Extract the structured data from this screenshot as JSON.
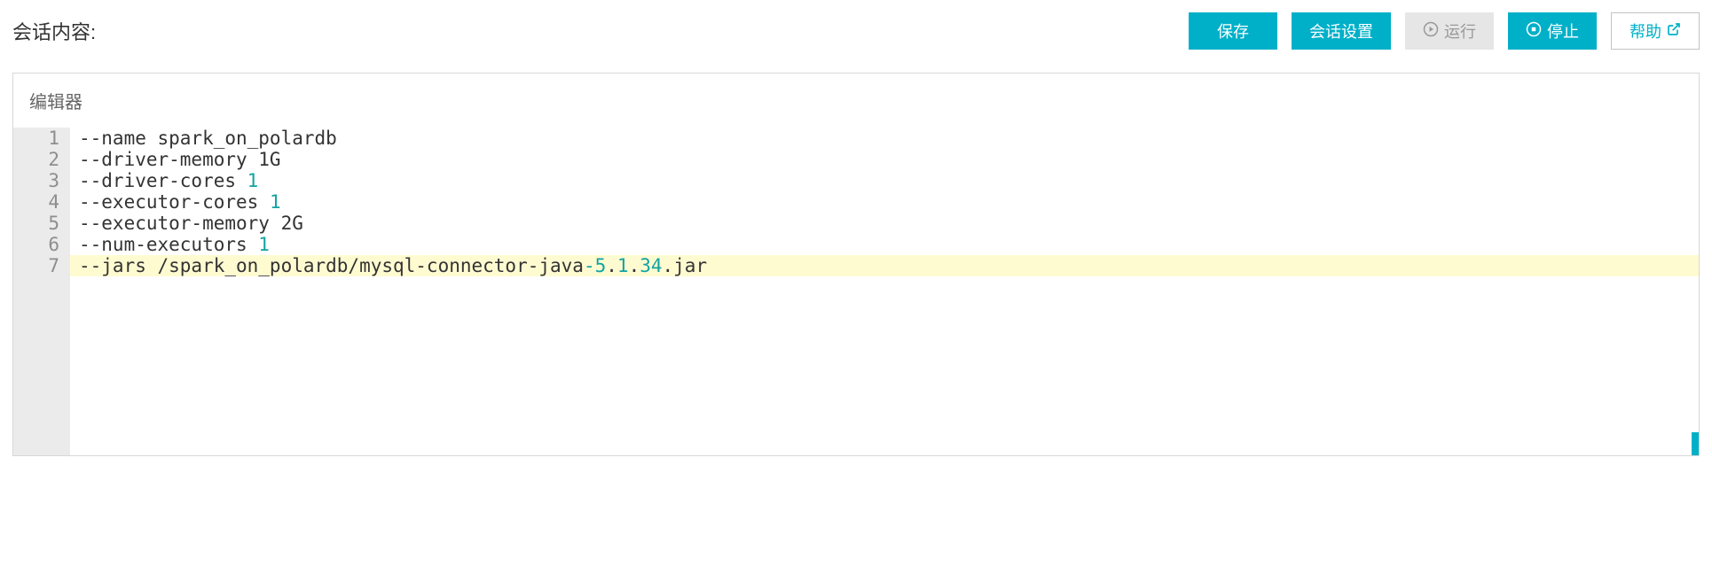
{
  "header": {
    "title": "会话内容:"
  },
  "buttons": {
    "save": "保存",
    "session_settings": "会话设置",
    "run": "运行",
    "stop": "停止",
    "help": "帮助"
  },
  "editor": {
    "label": "编辑器",
    "lines": [
      {
        "n": "1",
        "tokens": [
          {
            "t": "--name spark_on_polardb",
            "c": "plain"
          }
        ],
        "active": false
      },
      {
        "n": "2",
        "tokens": [
          {
            "t": "--driver-memory 1G",
            "c": "plain"
          }
        ],
        "active": false
      },
      {
        "n": "3",
        "tokens": [
          {
            "t": "--driver-cores ",
            "c": "plain"
          },
          {
            "t": "1",
            "c": "num"
          }
        ],
        "active": false
      },
      {
        "n": "4",
        "tokens": [
          {
            "t": "--executor-cores ",
            "c": "plain"
          },
          {
            "t": "1",
            "c": "num"
          }
        ],
        "active": false
      },
      {
        "n": "5",
        "tokens": [
          {
            "t": "--executor-memory 2G",
            "c": "plain"
          }
        ],
        "active": false
      },
      {
        "n": "6",
        "tokens": [
          {
            "t": "--num-executors ",
            "c": "plain"
          },
          {
            "t": "1",
            "c": "num"
          }
        ],
        "active": false
      },
      {
        "n": "7",
        "tokens": [
          {
            "t": "--jars /spark_on_polardb/mysql-connector-java",
            "c": "plain"
          },
          {
            "t": "-5",
            "c": "num"
          },
          {
            "t": ".",
            "c": "plain"
          },
          {
            "t": "1",
            "c": "num"
          },
          {
            "t": ".",
            "c": "plain"
          },
          {
            "t": "34",
            "c": "num"
          },
          {
            "t": ".jar",
            "c": "plain"
          }
        ],
        "active": true
      }
    ]
  }
}
